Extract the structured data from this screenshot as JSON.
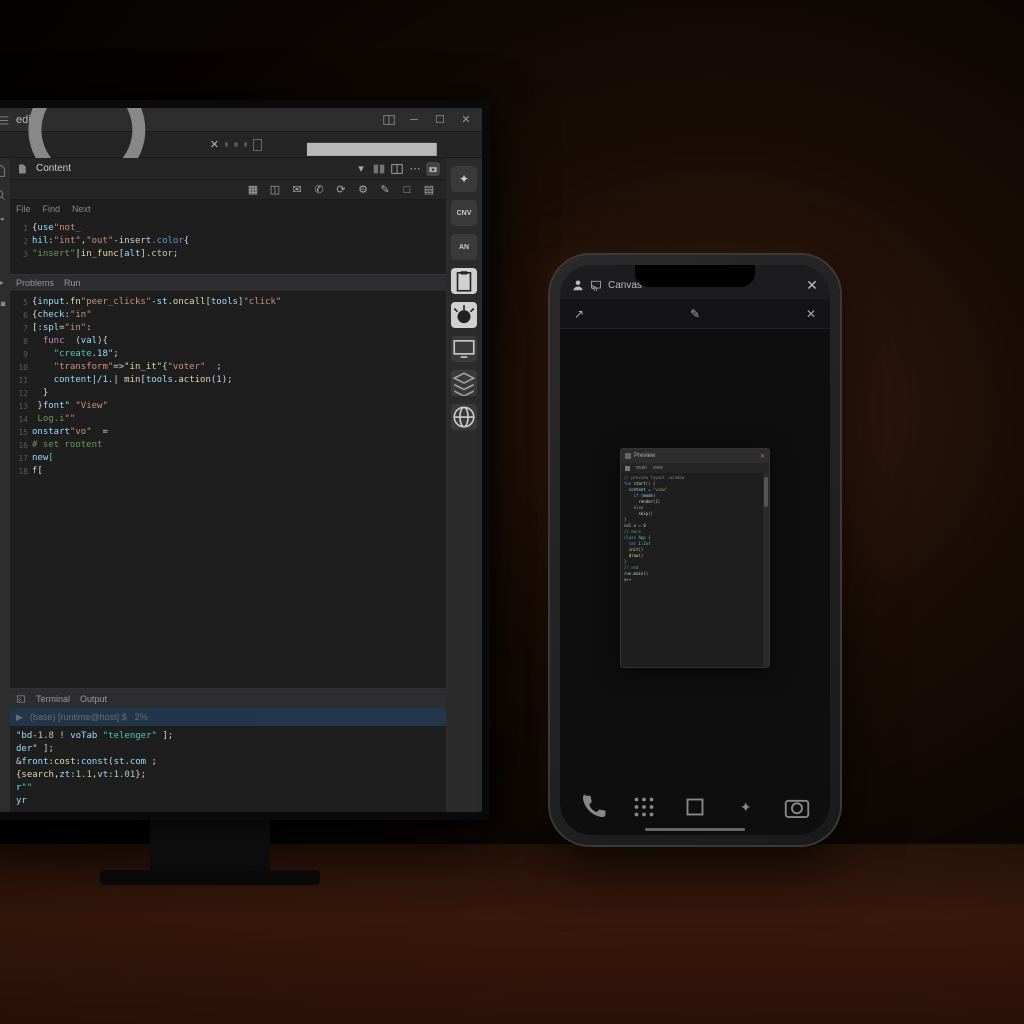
{
  "ide": {
    "title": "editor",
    "tab_label": "Content",
    "crumbs": [
      "File",
      "Find",
      "Next"
    ],
    "subtabs": [
      "Problems",
      "Run"
    ],
    "code_lines": [
      {
        "n": "1",
        "html": "<span class='d'>{</span><span class='v'>use</span><span class='s'>\"not_</span>"
      },
      {
        "n": "2",
        "html": "<span class='v'>hil</span><span class='d'>:</span><span class='s'>\"int\"</span><span class='d'>,</span><span class='s'>\"out\"</span><span class='d'>-insert</span><span class='k'>.color</span><span class='d'>{</span>"
      },
      {
        "n": "3",
        "html": "<span class='c'>\"insert\"</span><span class='d'>|</span><span class='f'>in_func</span><span class='d'>[</span><span class='v'>alt</span><span class='d'>]</span><span class='n'>.ctor</span><span class='d'>;</span>"
      },
      {
        "n": "",
        "html": ""
      }
    ],
    "code_lines2": [
      {
        "n": "5",
        "html": "<span class='d'>{</span><span class='v'>input</span><span class='d'>.</span><span class='f'>fn</span><span class='s'>\"peer_clicks\"</span><span class='d'>-</span><span class='v'>st</span><span class='d'>.</span><span class='f'>oncall</span><span class='d'>[</span><span class='v'>tools</span><span class='d'>]</span><span class='s'>\"click\"</span>"
      },
      {
        "n": "6",
        "html": "<span class='d'>{</span><span class='v'>check</span><span class='d'>:</span><span class='s'>\"in\"</span>"
      },
      {
        "n": "7",
        "html": "<span class='d'>[</span><span class='v'>:spl</span><span class='d'>=</span><span class='s'>\"in\"</span><span class='d'>:</span>"
      },
      {
        "n": "8",
        "html": "  <span class='p'>func</span><span class='d'>  (</span><span class='v'>val</span><span class='d'>){</span>"
      },
      {
        "n": "9",
        "html": "    <span class='t'>\"create</span><span class='v'>.18\"</span><span class='d'>;</span>"
      },
      {
        "n": "10",
        "html": "    <span class='s'>\"transform\"</span><span class='d'>=></span><span class='f'>\"in_it\"</span><span class='d'>{</span><span class='s'>\"voter\"</span>  <span class='d'>;</span>"
      },
      {
        "n": "11",
        "html": "    <span class='v'>content</span><span class='d'>|</span><span class='v'>/1.</span><span class='d'>|</span> <span class='f'>min</span><span class='d'>[</span><span class='v'>tools</span><span class='d'>.</span><span class='f'>action</span><span class='d'>(</span><span class='v'>1</span><span class='d'>);</span>"
      },
      {
        "n": "12",
        "html": "  <span class='d'>}</span>"
      },
      {
        "n": "13",
        "html": "<span class='d'> }</span><span class='v'>font\"</span> <span class='s'>\"View\"</span>"
      },
      {
        "n": "14",
        "html": "<span class='c'> Log.i</span><span class='s'>\"\"</span>"
      },
      {
        "n": "15",
        "html": "<span class='v'>onstart</span><span class='s'>\"vo\"</span>  <span class='d'>=</span>"
      },
      {
        "n": "16",
        "html": "<span class='c'># set rootent</span>"
      },
      {
        "n": "17",
        "html": "<span class='v'>new</span><span class='t'>[</span>"
      },
      {
        "n": "18",
        "html": "<span class='v'>f</span><span class='d'>[</span>"
      },
      {
        "n": "",
        "html": ""
      }
    ],
    "terminal_tabs": [
      "Terminal",
      "Output"
    ],
    "terminal_header": "(base) [runtime@host] $",
    "terminal_header_tag": "2%",
    "terminal_lines": [
      "<span class='d'>\"</span><span class='v'>bd</span><span class='d'>-</span><span class='n'>1.8</span> <span class='d'>!</span> <span class='v'>voTab</span> <span class='t'>\"telenger\"</span> <span class='d'>];</span>",
      "<span class='v'>der</span><span class='d'>\"</span> <span class='d'>];</span>",
      "<span class='d'>&</span><span class='v'>front</span><span class='d'>:</span><span class='f'>cost</span><span class='d'>:</span><span class='v'>const</span><span class='d'>(</span><span class='v'>st</span><span class='d'>.</span><span class='v'>com</span><span class='d'> ;</span>",
      "  <span class='d'>{</span><span class='f'>search</span><span class='d'>,</span><span class='v'>zt</span><span class='d'>:</span><span class='n'>1.1</span><span class='d'>,</span><span class='v'>vt</span><span class='d'>:</span><span class='n'>1.01</span><span class='d'>};</span>",
      "<span class='v'>r</span><span class='t'>\"\"</span>",
      "<span class='v'>yr</span>"
    ],
    "rightbar_labels": {
      "cnv": "CNV",
      "an": "AN"
    }
  },
  "phone": {
    "topbar_title": "Canvas",
    "mini_title": "Preview",
    "mini_tabs": [
      "main",
      "view"
    ],
    "mini_lines": [
      "<span class='c'>// preview layout :window</span>",
      "<span class='k'>fun</span> <span class='f'>start</span>() {",
      "  <span class='v'>content</span> = <span class='s'>\"view\"</span>",
      "    <span class='p'>if</span> (<span class='v'>mode</span>)",
      "      <span class='f'>render</span>(<span class='n'>1</span>)",
      "    <span class='p'>else</span>",
      "      <span class='f'>skip</span>()",
      "}",
      "<span class='v'>val</span> <span class='v'>x</span> = <span class='n'>0</span>",
      "<span class='c'>// more</span>",
      "<span class='k'>class</span> <span class='t'>App</span> {",
      "  <span class='k'>var</span> <span class='v'>i</span>:<span class='t'>Int</span>",
      "  <span class='f'>init</span>()",
      "  <span class='f'>draw</span>()",
      "}",
      "",
      "<span class='c'>// end</span>",
      "<span class='v'>run</span>.<span class='f'>main</span>()",
      "",
      "",
      "<span class='v'>x</span>++",
      ""
    ]
  }
}
